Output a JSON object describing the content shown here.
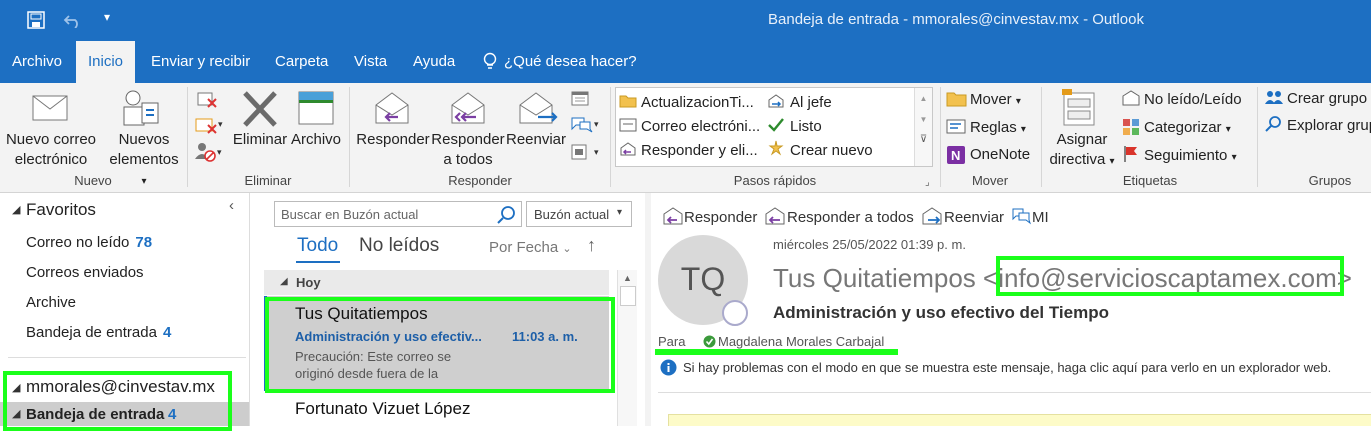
{
  "window": {
    "title": "Bandeja de entrada - mmorales@cinvestav.mx  -  Outlook"
  },
  "tabs": [
    "Archivo",
    "Inicio",
    "Enviar y recibir",
    "Carpeta",
    "Vista",
    "Ayuda"
  ],
  "tell_me": "¿Qué desea hacer?",
  "ribbon": {
    "nuevo": {
      "new_email_1": "Nuevo correo",
      "new_email_2": "electrónico",
      "new_items_1": "Nuevos",
      "new_items_2": "elementos",
      "label": "Nuevo"
    },
    "eliminar": {
      "delete": "Eliminar",
      "archive": "Archivo",
      "label": "Eliminar"
    },
    "responder": {
      "reply": "Responder",
      "reply_all_1": "Responder",
      "reply_all_2": "a todos",
      "forward": "Reenviar",
      "label": "Responder"
    },
    "pasos": {
      "items": [
        "ActualizacionTi...",
        "Correo electróni...",
        "Responder y eli...",
        "Al jefe",
        "Listo",
        "Crear nuevo"
      ],
      "label": "Pasos rápidos"
    },
    "mover": {
      "move": "Mover",
      "rules": "Reglas",
      "onenote": "OneNote",
      "label": "Mover"
    },
    "etiquetas": {
      "assign_1": "Asignar",
      "assign_2": "directiva",
      "unread": "No leído/Leído",
      "categorize": "Categorizar",
      "followup": "Seguimiento",
      "label": "Etiquetas"
    },
    "grupos": {
      "create": "Crear grupo",
      "explore": "Explorar grup",
      "label": "Grupos"
    }
  },
  "nav": {
    "favorites": "Favoritos",
    "items": [
      {
        "label": "Correo no leído",
        "count": "78"
      },
      {
        "label": "Correos enviados",
        "count": ""
      },
      {
        "label": "Archive",
        "count": ""
      },
      {
        "label": "Bandeja de entrada",
        "count": "4"
      }
    ],
    "account": "mmorales@cinvestav.mx",
    "inbox": {
      "label": "Bandeja de entrada",
      "count": "4"
    }
  },
  "list": {
    "search_placeholder": "Buscar en Buzón actual",
    "scope": "Buzón actual",
    "tab_all": "Todo",
    "tab_unread": "No leídos",
    "sort": "Por Fecha",
    "group": "Hoy",
    "messages": [
      {
        "sender": "Tus Quitatiempos",
        "subject": "Administración y uso efectiv...",
        "time": "11:03 a. m.",
        "preview_1": "Precaución: Este correo se",
        "preview_2": "originó desde fuera de la"
      },
      {
        "sender": "Fortunato Vizuet López"
      }
    ]
  },
  "reading": {
    "actions": [
      "Responder",
      "Responder a todos",
      "Reenviar",
      "MI"
    ],
    "date": "miércoles 25/05/2022 01:39 p. m.",
    "initials": "TQ",
    "sender_name": "Tus Quitatiempos",
    "sender_email": "info@servicioscaptamex.com",
    "subject": "Administración y uso efectivo del Tiempo",
    "to_label": "Para",
    "to_name": "Magdalena Morales Carbajal",
    "info": "Si hay problemas con el modo en que se muestra este mensaje, haga clic aquí para verlo en un explorador web."
  }
}
